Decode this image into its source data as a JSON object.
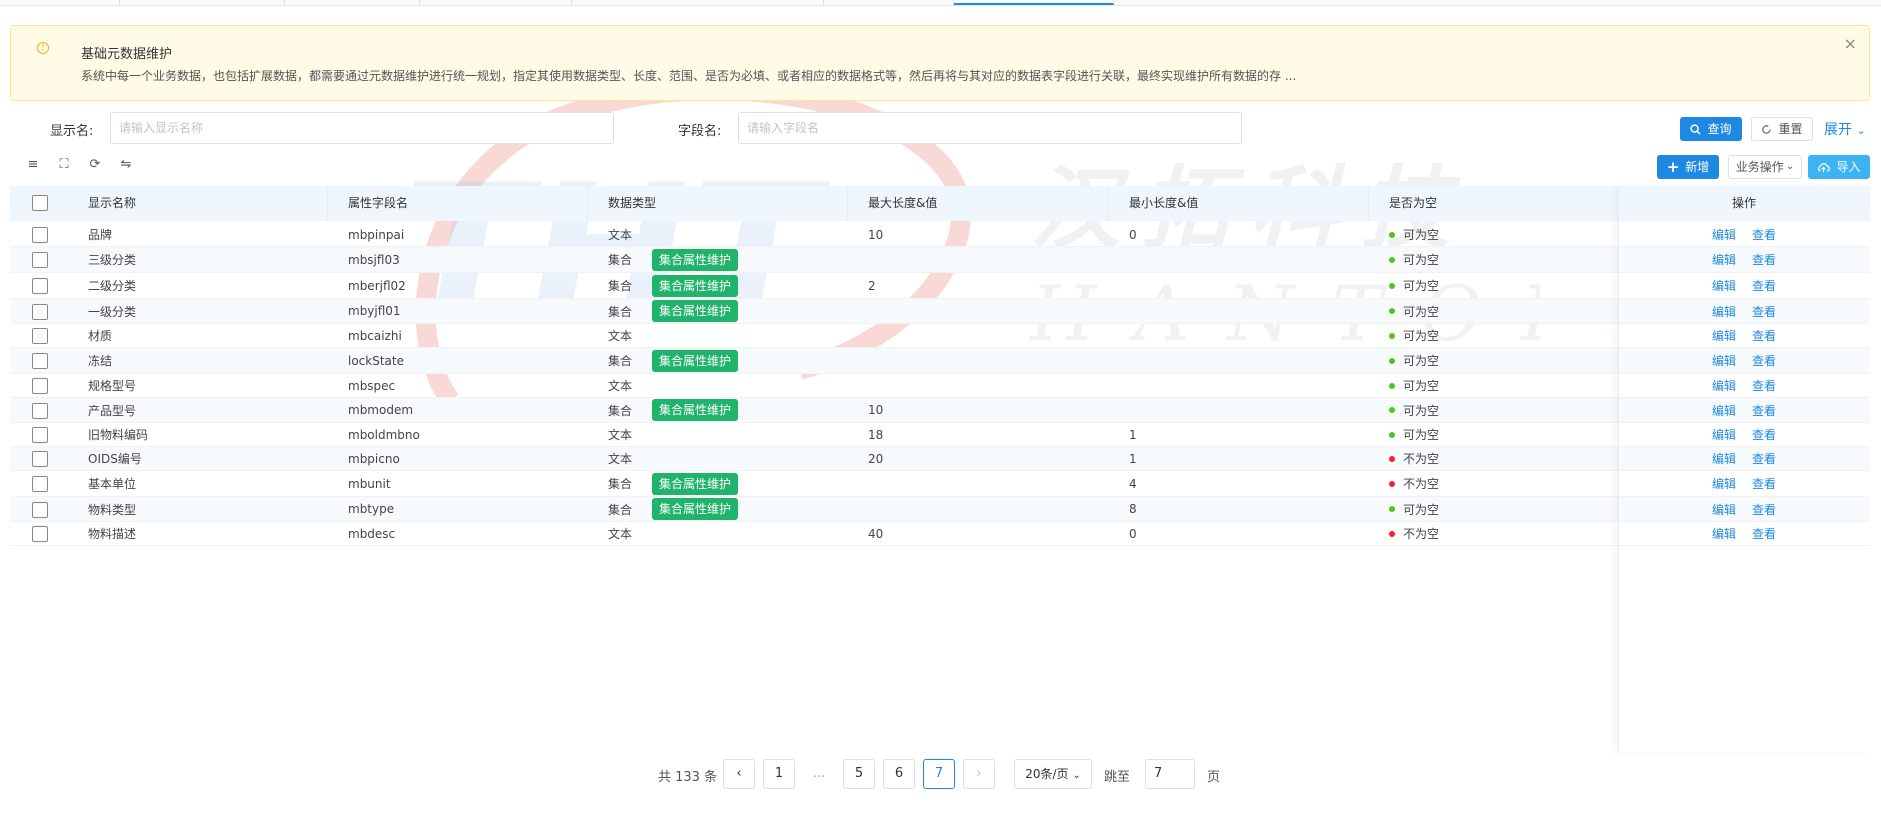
{
  "alert": {
    "title": "基础元数据维护",
    "description": "系统中每一个业务数据，也包括扩展数据，都需要通过元数据维护进行统一规划，指定其使用数据类型、长度、范围、是否为必填、或者相应的数据格式等，然后再将与其对应的数据表字段进行关联，最终实现维护所有数据的存 ...",
    "close": "×"
  },
  "search": {
    "display_label": "显示名:",
    "display_placeholder": "请输入显示名称",
    "field_label": "字段名:",
    "field_placeholder": "请输入字段名",
    "query": "查询",
    "reset": "重置",
    "expand": "展开"
  },
  "toolbar": {
    "add": "新增",
    "business_ops": "业务操作",
    "import": "导入"
  },
  "table": {
    "headers": [
      "显示名称",
      "属性字段名",
      "数据类型",
      "最大长度&值",
      "最小长度&值",
      "是否为空",
      "操作"
    ],
    "collection_btn": "集合属性维护",
    "edit": "编辑",
    "view": "查看",
    "rows": [
      {
        "name": "品牌",
        "field": "mbpinpai",
        "type": "文本",
        "collection": false,
        "max": "10",
        "min": "0",
        "nullable": "可为空",
        "ok": true
      },
      {
        "name": "三级分类",
        "field": "mbsjfl03",
        "type": "集合",
        "collection": true,
        "max": "",
        "min": "",
        "nullable": "可为空",
        "ok": true
      },
      {
        "name": "二级分类",
        "field": "mberjfl02",
        "type": "集合",
        "collection": true,
        "max": "2",
        "min": "",
        "nullable": "可为空",
        "ok": true
      },
      {
        "name": "一级分类",
        "field": "mbyjfl01",
        "type": "集合",
        "collection": true,
        "max": "",
        "min": "",
        "nullable": "可为空",
        "ok": true
      },
      {
        "name": "材质",
        "field": "mbcaizhi",
        "type": "文本",
        "collection": false,
        "max": "",
        "min": "",
        "nullable": "可为空",
        "ok": true
      },
      {
        "name": "冻结",
        "field": "lockState",
        "type": "集合",
        "collection": true,
        "max": "",
        "min": "",
        "nullable": "可为空",
        "ok": true
      },
      {
        "name": "规格型号",
        "field": "mbspec",
        "type": "文本",
        "collection": false,
        "max": "",
        "min": "",
        "nullable": "可为空",
        "ok": true
      },
      {
        "name": "产品型号",
        "field": "mbmodem",
        "type": "集合",
        "collection": true,
        "max": "10",
        "min": "",
        "nullable": "可为空",
        "ok": true
      },
      {
        "name": "旧物料编码",
        "field": "mboldmbno",
        "type": "文本",
        "collection": false,
        "max": "18",
        "min": "1",
        "nullable": "可为空",
        "ok": true
      },
      {
        "name": "OIDS编号",
        "field": "mbpicno",
        "type": "文本",
        "collection": false,
        "max": "20",
        "min": "1",
        "nullable": "不为空",
        "ok": false
      },
      {
        "name": "基本单位",
        "field": "mbunit",
        "type": "集合",
        "collection": true,
        "max": "",
        "min": "4",
        "nullable": "不为空",
        "ok": false
      },
      {
        "name": "物料类型",
        "field": "mbtype",
        "type": "集合",
        "collection": true,
        "max": "",
        "min": "8",
        "nullable": "可为空",
        "ok": true
      },
      {
        "name": "物料描述",
        "field": "mbdesc",
        "type": "文本",
        "collection": false,
        "max": "40",
        "min": "0",
        "nullable": "不为空",
        "ok": false
      }
    ]
  },
  "pagination": {
    "total": "共 133 条",
    "pages": [
      "1",
      "...",
      "5",
      "6",
      "7"
    ],
    "current": "7",
    "page_size": "20条/页",
    "jump_label": "跳至",
    "jump_value": "7",
    "page_unit": "页"
  },
  "watermark": {
    "logo": "THT",
    "cn": "汉拓科技",
    "en": "HANTOP"
  },
  "colors": {
    "primary": "#1e88e5",
    "green_tag": "#20b36a",
    "ok_dot": "#52c41a",
    "bad_dot": "#f5222d"
  }
}
